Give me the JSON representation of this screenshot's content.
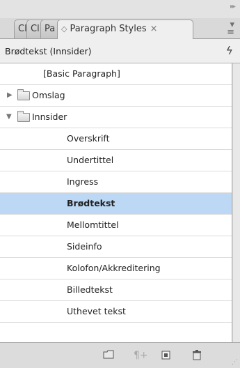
{
  "panel": {
    "tabs": [
      {
        "label": "Cl"
      },
      {
        "label": "Cl"
      },
      {
        "label": "Pa"
      },
      {
        "label": "Paragraph Styles",
        "close": "×"
      }
    ],
    "collapse_icon": "double-chevron-right-icon",
    "menu_icon": "panel-menu-icon",
    "current_style": "Brødtekst (Innsider)",
    "quick_apply_icon": "lightning-icon"
  },
  "styles": [
    {
      "label": "[Basic Paragraph]",
      "level": 0,
      "type": "style"
    },
    {
      "label": "Omslag",
      "level": 0,
      "type": "folder",
      "expanded": false
    },
    {
      "label": "Innsider",
      "level": 0,
      "type": "folder",
      "expanded": true
    },
    {
      "label": "Overskrift",
      "level": 1,
      "type": "style"
    },
    {
      "label": "Undertittel",
      "level": 1,
      "type": "style"
    },
    {
      "label": "Ingress",
      "level": 1,
      "type": "style"
    },
    {
      "label": "Brødtekst",
      "level": 1,
      "type": "style",
      "selected": true
    },
    {
      "label": "Mellomtittel",
      "level": 1,
      "type": "style"
    },
    {
      "label": "Sideinfo",
      "level": 1,
      "type": "style"
    },
    {
      "label": "Kolofon/Akkreditering",
      "level": 1,
      "type": "style"
    },
    {
      "label": "Billedtekst",
      "level": 1,
      "type": "style"
    },
    {
      "label": "Uthevet tekst",
      "level": 1,
      "type": "style"
    }
  ],
  "bottom_toolbar": [
    {
      "name": "new-style-group-icon"
    },
    {
      "name": "clear-overrides-icon",
      "disabled": true
    },
    {
      "name": "new-style-icon"
    },
    {
      "name": "delete-style-icon"
    }
  ],
  "colors": {
    "selection": "#bcd8f5",
    "panel_bg": "#efefef"
  }
}
